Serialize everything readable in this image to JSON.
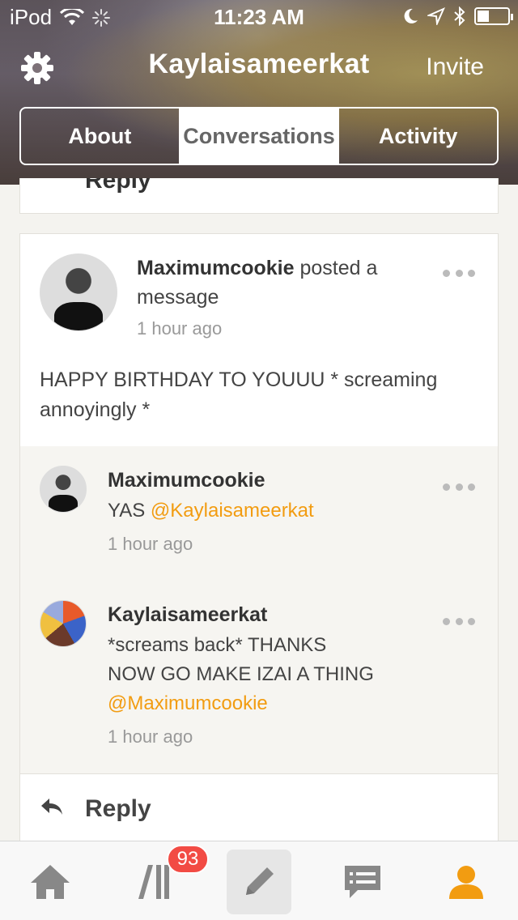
{
  "status_bar": {
    "carrier": "iPod",
    "time": "11:23 AM"
  },
  "nav": {
    "title": "Kaylaisameerkat",
    "invite_label": "Invite"
  },
  "tabs": [
    {
      "label": "About",
      "active": false
    },
    {
      "label": "Conversations",
      "active": true
    },
    {
      "label": "Activity",
      "active": false
    }
  ],
  "previous_card": {
    "reply_label": "Reply"
  },
  "post": {
    "author": "Maximumcookie",
    "action": "posted a message",
    "time": "1 hour ago",
    "body": "HAPPY BIRTHDAY TO YOUUU * screaming annoyingly *",
    "replies": [
      {
        "author": "Maximumcookie",
        "text": "YAS ",
        "mention": "@Kaylaisameerkat",
        "time": "1 hour ago"
      },
      {
        "author": "Kaylaisameerkat",
        "text_line1": "*screams back* THANKS",
        "text_line2": "NOW GO MAKE IZAI A THING",
        "mention": "@Maximumcookie",
        "time": "1 hour ago"
      }
    ],
    "reply_label": "Reply"
  },
  "tab_bar": {
    "badge_count": "93",
    "accent_color": "#f29c11",
    "icons": [
      "home-icon",
      "library-icon",
      "compose-icon",
      "messages-icon",
      "profile-icon"
    ]
  }
}
